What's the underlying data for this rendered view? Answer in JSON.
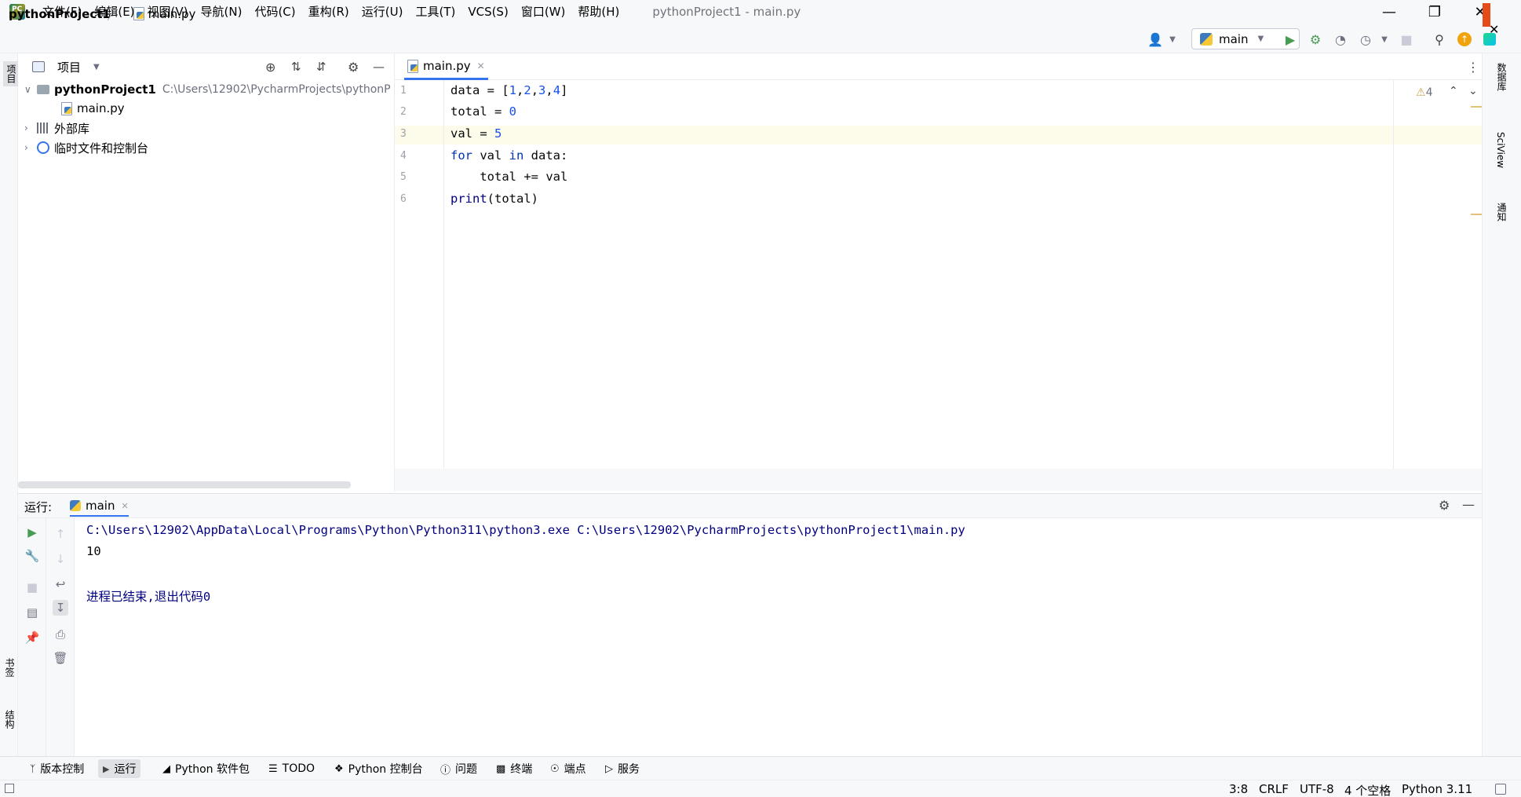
{
  "titlebar": {
    "app_logo_text": "PC",
    "menu": [
      "文件(F)",
      "编辑(E)",
      "视图(V)",
      "导航(N)",
      "代码(C)",
      "重构(R)",
      "运行(U)",
      "工具(T)",
      "VCS(S)",
      "窗口(W)",
      "帮助(H)"
    ],
    "window_title": "pythonProject1 - main.py"
  },
  "navbar": {
    "project": "pythonProject1",
    "file": "main.py",
    "run_config": "main"
  },
  "left_strip": {
    "project_label": "项目",
    "bookmarks_label": "书签",
    "structure_label": "结构"
  },
  "right_strip": {
    "database_label": "数据库",
    "sciview_label": "SciView",
    "notifications_label": "通知"
  },
  "project_panel": {
    "title": "项目",
    "tree": [
      {
        "label": "pythonProject1",
        "path": "C:\\Users\\12902\\PycharmProjects\\pythonP"
      },
      {
        "label": "main.py"
      },
      {
        "label": "外部库"
      },
      {
        "label": "临时文件和控制台"
      }
    ]
  },
  "editor": {
    "tab": "main.py",
    "warnings": "4",
    "line_numbers": [
      "1",
      "2",
      "3",
      "4",
      "5",
      "6"
    ]
  },
  "run_panel": {
    "label": "运行:",
    "tab": "main",
    "console": [
      "C:\\Users\\12902\\AppData\\Local\\Programs\\Python\\Python311\\python3.exe C:\\Users\\12902\\PycharmProjects\\pythonProject1\\main.py",
      "10",
      "",
      "进程已结束,退出代码0"
    ]
  },
  "toolwindows": [
    "版本控制",
    "运行",
    "Python 软件包",
    "TODO",
    "Python 控制台",
    "问题",
    "终端",
    "端点",
    "服务"
  ],
  "statusbar": {
    "position": "3:8",
    "line_sep": "CRLF",
    "encoding": "UTF-8",
    "indent": "4 个空格",
    "interpreter": "Python 3.11"
  },
  "colors": {
    "accent": "#3574f0",
    "run_green": "#499c54",
    "keyword": "#0033b3",
    "number": "#1750eb",
    "console_path": "#000080"
  }
}
